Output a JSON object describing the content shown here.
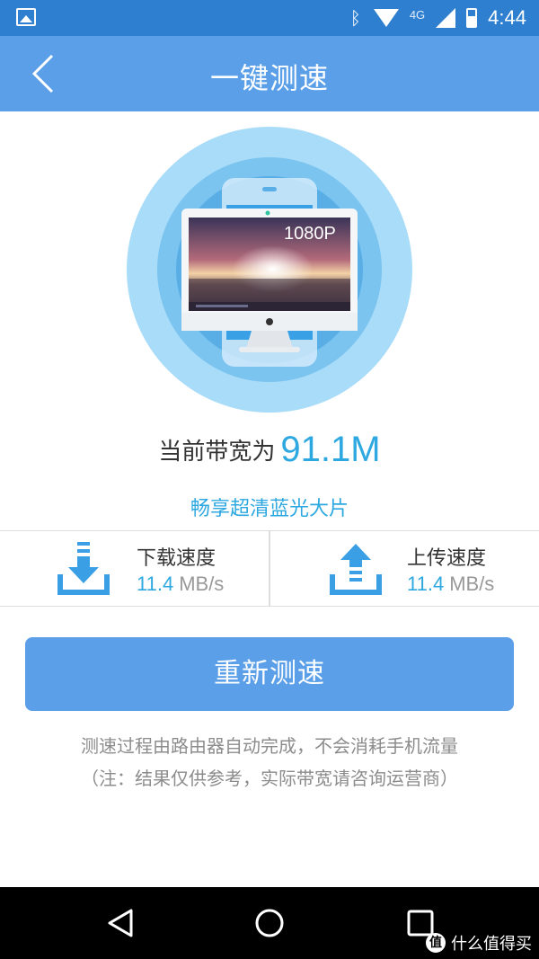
{
  "status_bar": {
    "network": "4G",
    "time": "4:44",
    "icons": [
      "image-icon",
      "bluetooth-icon",
      "wifi-icon",
      "signal-icon",
      "battery-icon"
    ]
  },
  "header": {
    "title": "一键测速",
    "back_icon": "chevron-left-icon"
  },
  "hero": {
    "resolution_badge": "1080P"
  },
  "result": {
    "bandwidth_label": "当前带宽为",
    "bandwidth_value": "91.1M",
    "quality_text": "畅享超清蓝光大片"
  },
  "speeds": {
    "download": {
      "label": "下载速度",
      "value": "11.4",
      "unit": "MB/s",
      "icon": "download-icon"
    },
    "upload": {
      "label": "上传速度",
      "value": "11.4",
      "unit": "MB/s",
      "icon": "upload-icon"
    }
  },
  "actions": {
    "retest_label": "重新测速"
  },
  "notes": {
    "line1": "测速过程由路由器自动完成，不会消耗手机流量",
    "line2": "（注：结果仅供参考，实际带宽请咨询运营商）"
  },
  "nav_bar": {
    "icons": [
      "back-triangle-icon",
      "home-circle-icon",
      "recent-square-icon"
    ]
  },
  "watermark": {
    "logo": "值",
    "text": "什么值得买"
  },
  "colors": {
    "status_bar": "#2f7fd0",
    "header": "#5a9fe8",
    "accent": "#2ea8e0",
    "button": "#5a9fe8"
  }
}
